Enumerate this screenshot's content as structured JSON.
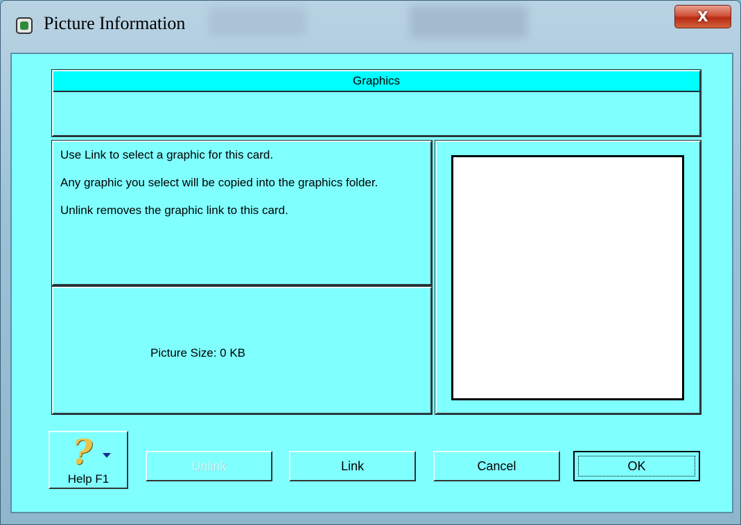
{
  "window": {
    "title": "Picture Information",
    "close_glyph": "X",
    "app_icon": "picture-icon"
  },
  "graphics": {
    "header": "Graphics"
  },
  "info": {
    "line1": "Use Link to select a graphic for this card.",
    "line2": "Any graphic you select will be copied into the graphics folder.",
    "line3": "Unlink removes the graphic link to this card."
  },
  "size": {
    "label": "Picture Size:   0 KB"
  },
  "buttons": {
    "help": {
      "icon": "question-mark-icon",
      "glyph": "?",
      "label": "Help F1"
    },
    "unlink": {
      "label": "Unlink",
      "enabled": false
    },
    "link": {
      "label": "Link"
    },
    "cancel": {
      "label": "Cancel"
    },
    "ok": {
      "label": "OK"
    }
  },
  "colors": {
    "dialog_bg": "#80ffff",
    "header_bg": "#00ffff",
    "preview_bg": "#ffffff"
  }
}
